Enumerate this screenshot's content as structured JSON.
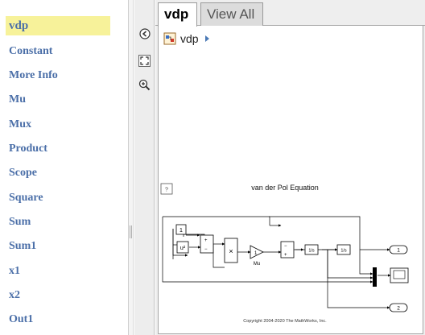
{
  "nav": {
    "items": [
      {
        "label": "vdp",
        "selected": true
      },
      {
        "label": "Constant"
      },
      {
        "label": "More Info"
      },
      {
        "label": "Mu"
      },
      {
        "label": "Mux"
      },
      {
        "label": "Product"
      },
      {
        "label": "Scope"
      },
      {
        "label": "Square"
      },
      {
        "label": "Sum"
      },
      {
        "label": "Sum1"
      },
      {
        "label": "x1"
      },
      {
        "label": "x2"
      },
      {
        "label": "Out1"
      }
    ]
  },
  "toolbar": {
    "icons": [
      "back-icon",
      "fit-to-view-icon",
      "zoom-in-icon"
    ]
  },
  "tabs": [
    {
      "label": "vdp",
      "active": true
    },
    {
      "label": "View All",
      "active": false
    }
  ],
  "breadcrumb": {
    "model_icon": "simulink-model-icon",
    "label": "vdp"
  },
  "diagram": {
    "title": "van der Pol Equation",
    "copyright": "Copyright 2004-2020 The MathWorks, Inc.",
    "info_block": "?",
    "constant_value": "1",
    "square_label": "u²",
    "product_symbol": "×",
    "gain_label": "Mu",
    "gain_value": "1",
    "integrator_label": "1/s",
    "out1_label": "1",
    "out2_label": "2",
    "sum_signs_top": "+",
    "sum_signs_bottom": "−"
  },
  "colors": {
    "nav_link": "#4b6fa8",
    "nav_selected_bg": "#f7f29a",
    "breadcrumb_arrow": "#4a79b5"
  }
}
